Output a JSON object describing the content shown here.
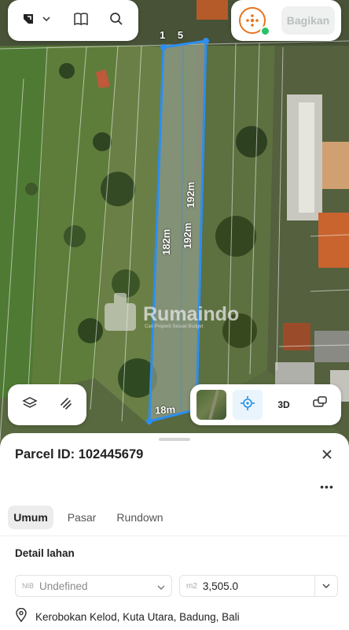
{
  "toolbar": {
    "icons": [
      "brand-logo-icon",
      "chevron-down-icon",
      "book-icon",
      "search-icon"
    ],
    "share_label": "Bagikan"
  },
  "map": {
    "marker_label": "1 5",
    "dimensions": {
      "left_side": "182m",
      "right_side_inner": "192m",
      "right_side_outer": "192m",
      "bottom": "18m"
    },
    "watermark": {
      "brand": "Rumaindo",
      "tagline": "Cari Properti Sesuai Budget"
    }
  },
  "map_controls": {
    "left_icons": [
      "layers-icon",
      "measure-icon"
    ],
    "right_icons": [
      "satellite-thumbnail",
      "locate-icon",
      "3d-toggle",
      "parcel-select-icon"
    ],
    "three_d_label": "3D"
  },
  "parcel": {
    "title": "Parcel ID: 102445679",
    "tabs": [
      {
        "label": "Umum",
        "active": true
      },
      {
        "label": "Pasar",
        "active": false
      },
      {
        "label": "Rundown",
        "active": false
      }
    ],
    "section_title": "Detail lahan",
    "nib_prefix": "NIB",
    "nib_value": "Undefined",
    "area_unit": "m2",
    "area_value": "3,505.0",
    "address": "Kerobokan Kelod, Kuta Utara, Badung, Bali"
  },
  "colors": {
    "accent": "#1e8fe6",
    "parcel_border": "#2b8ef0",
    "brand_orange": "#e8731c",
    "status_green": "#27c26a"
  }
}
